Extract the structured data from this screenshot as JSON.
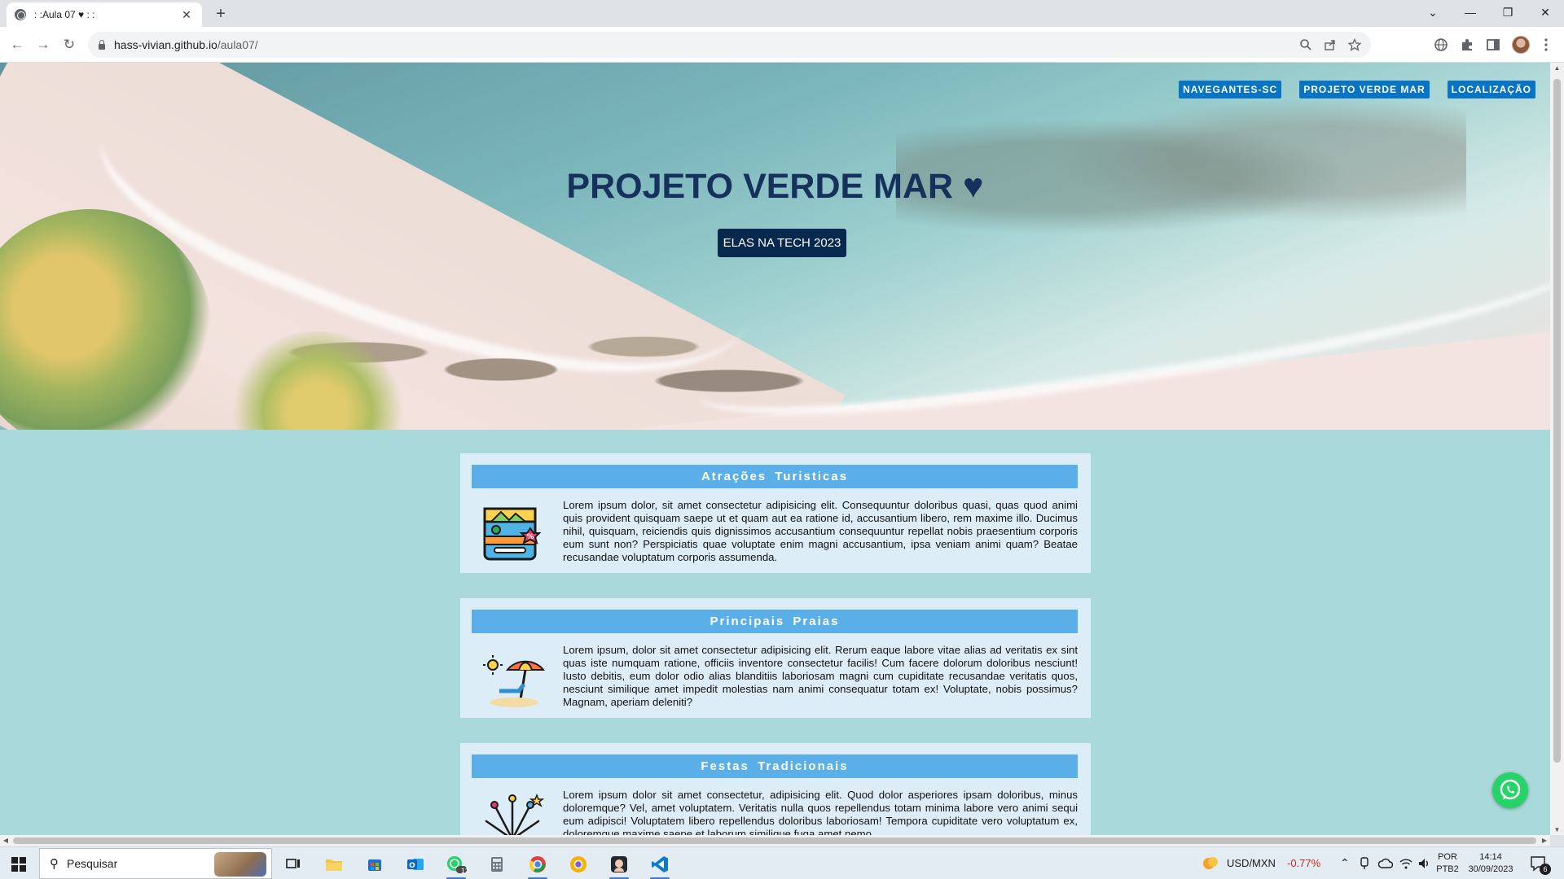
{
  "browser": {
    "tab_title": ": :Aula 07 ♥ : :",
    "tab_close": "✕",
    "new_tab": "+",
    "url_host": "hass-vivian.github.io",
    "url_path": "/aula07/",
    "window_controls": {
      "dropdown": "⌄",
      "minimize": "—",
      "restore": "❐",
      "close": "✕"
    },
    "nav": {
      "back": "←",
      "forward": "→",
      "reload": "↻"
    }
  },
  "page": {
    "nav_links": [
      "NAVEGANTES-SC",
      "PROJETO VERDE MAR",
      "LOCALIZAÇÃO"
    ],
    "hero_title": "PROJETO VERDE MAR ♥",
    "hero_badge": "ELAS NA TECH 2023",
    "sections": [
      {
        "title": "Atrações Turisticas",
        "icon": "map-discount-icon",
        "text": "Lorem ipsum dolor, sit amet consectetur adipisicing elit. Consequuntur doloribus quasi, quas quod animi quis provident quisquam saepe ut et quam aut ea ratione id, accusantium libero, rem maxime illo. Ducimus nihil, quisquam, reiciendis quis dignissimos accusantium consequuntur repellat nobis praesentium corporis eum sunt non? Perspiciatis quae voluptate enim magni accusantium, ipsa veniam animi quam? Beatae recusandae voluptatum corporis assumenda."
      },
      {
        "title": "Principais Praias",
        "icon": "beach-umbrella-icon",
        "text": "Lorem ipsum, dolor sit amet consectetur adipisicing elit. Rerum eaque labore vitae alias ad veritatis ex sint quas iste numquam ratione, officiis inventore consectetur facilis! Cum facere dolorum doloribus nesciunt! Iusto debitis, eum dolor odio alias blanditiis laboriosam magni cum cupiditate recusandae veritatis quos, nesciunt similique amet impedit molestias nam animi consequatur totam ex! Voluptate, nobis possimus? Magnam, aperiam deleniti?"
      },
      {
        "title": "Festas Tradicionais",
        "icon": "fireworks-icon",
        "text": "Lorem ipsum dolor sit amet consectetur, adipisicing elit. Quod dolor asperiores ipsam doloribus, minus doloremque? Vel, amet voluptatem. Veritatis nulla quos repellendus totam minima labore vero animi sequi eum adipisci! Voluptatem libero repellendus doloribus laboriosam! Tempora cupiditate vero voluptatum ex, doloremque maxime saepe et laborum similique fuga amet nemo."
      }
    ]
  },
  "taskbar": {
    "search_placeholder": "Pesquisar",
    "whatsapp_badge": "12",
    "ticker_label": "USD/MXN",
    "ticker_change": "-0.77%",
    "ticker_change_color": "#c42b1c",
    "language_top": "POR",
    "language_bottom": "PTB2",
    "time": "14:14",
    "date": "30/09/2023",
    "notification_count": "6"
  },
  "colors": {
    "page_bg": "#a9d9da",
    "card_bg": "#dcedf7",
    "section_bar": "#5aafe8",
    "nav_link_bg": "#0a74c4",
    "hero_title": "#16325c",
    "hero_badge_bg": "#07294d",
    "whatsapp": "#25d366"
  }
}
